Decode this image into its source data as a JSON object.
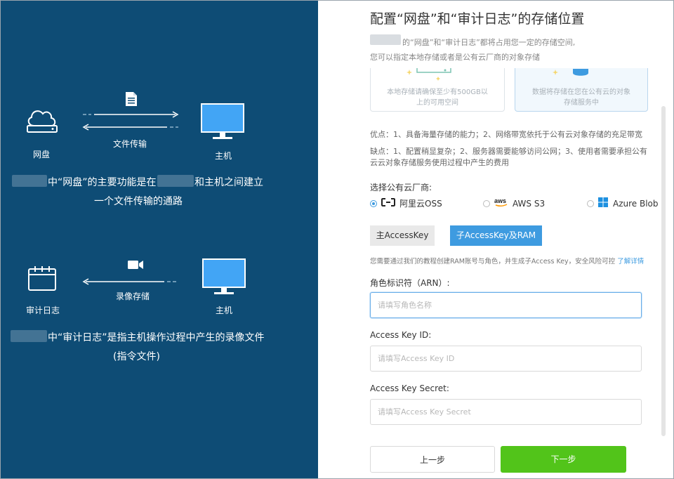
{
  "left": {
    "netdisk": {
      "disk_label": "网盘",
      "transfer_label": "文件传输",
      "host_label": "主机",
      "desc_line1_mid": "中“网盘”的主要功能是在",
      "desc_line1_end": "和主机之间建立",
      "desc_line2": "一个文件传输的通路"
    },
    "audit": {
      "log_label": "审计日志",
      "record_label": "录像存储",
      "host_label": "主机",
      "desc_line1": "中“审计日志”是指主机操作过程中产生的录像文件",
      "desc_line2": "(指令文件)"
    }
  },
  "right": {
    "title": "配置“网盘”和“审计日志”的存储位置",
    "subtitle_line1": "的“网盘”和“审计日志”都将占用您一定的存储空间,",
    "subtitle_line2": "您可以指定本地存储或者是公有云厂商的对象存储",
    "cards": {
      "local_desc": "本地存储请确保至少有500GB以上的可用空间",
      "cloud_desc": "数据将存储在您在公有云的对象存储服务中"
    },
    "pros": "优点：1、具备海量存储的能力；2、网络带宽依托于公有云对象存储的充足带宽",
    "cons_line1": "缺点：1、配置稍显复杂；2、服务器需要能够访问公网；3、使用者需要承担公有",
    "cons_line2": "云云对象存储服务使用过程中产生的费用",
    "vendor_label": "选择公有云厂商:",
    "vendors": [
      {
        "label": "阿里云OSS",
        "selected": true,
        "icon": "aliyun-icon"
      },
      {
        "label": "AWS S3",
        "selected": false,
        "icon": "aws-icon"
      },
      {
        "label": "Azure Blob",
        "selected": false,
        "icon": "windows-icon"
      }
    ],
    "tabs": {
      "main_key": "主AccessKey",
      "sub_key": "子AccessKey及RAM"
    },
    "hint": "您需要通过我们的教程创建RAM账号与角色，并生成子Access Key，安全风险可控",
    "hint_link": "了解详情",
    "fields": {
      "arn_label": "角色标识符（ARN）:",
      "arn_placeholder": "请填写角色名称",
      "key_id_label": "Access Key ID:",
      "key_id_placeholder": "请填写Access Key ID",
      "secret_label": "Access Key Secret:",
      "secret_placeholder": "请填写Access Key Secret"
    },
    "buttons": {
      "prev": "上一步",
      "next": "下一步"
    }
  },
  "colors": {
    "left_bg": "#0e4c75",
    "primary_blue": "#3e9be0",
    "next_green": "#52c41a",
    "monitor_blue": "#42a5f5"
  }
}
